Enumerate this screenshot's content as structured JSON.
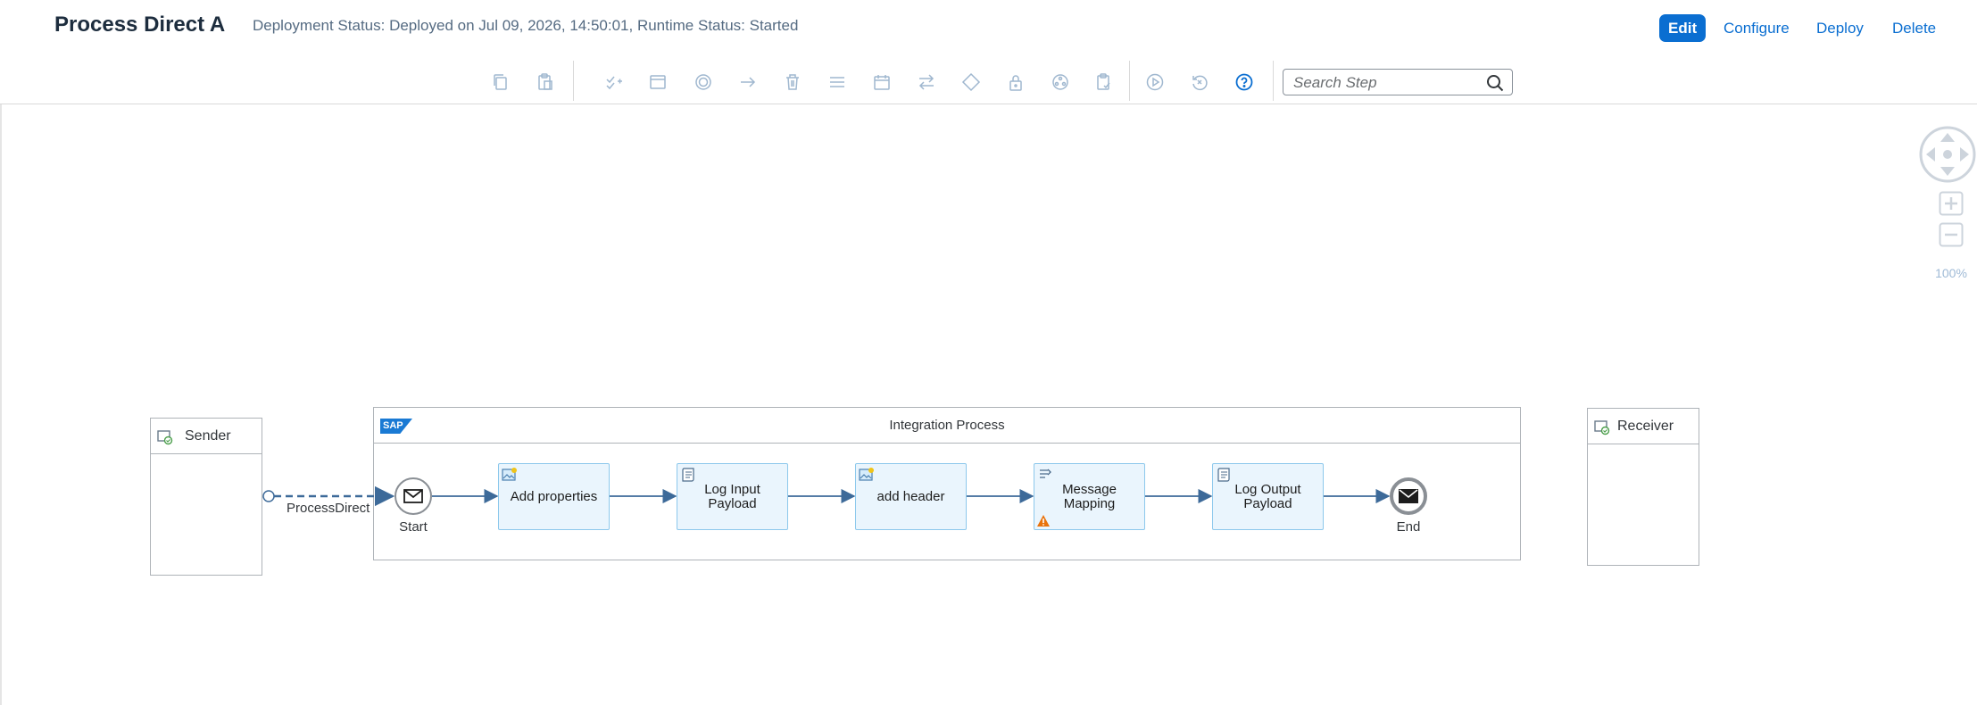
{
  "header": {
    "title": "Process Direct A",
    "status": "Deployment Status: Deployed on Jul 09, 2026, 14:50:01, Runtime Status: Started",
    "buttons": {
      "edit": "Edit",
      "configure": "Configure",
      "deploy": "Deploy",
      "delete": "Delete"
    }
  },
  "toolbar": {
    "tools": [
      "copy-icon",
      "paste-icon",
      "checklist-icon",
      "participant-icon",
      "events-icon",
      "connector-icon",
      "delete-icon",
      "menu-icon",
      "schedule-icon",
      "routing-icon",
      "gateway-icon",
      "security-icon",
      "call-icon",
      "validate-icon",
      "simulate-icon",
      "reset-icon",
      "help-icon"
    ],
    "search": {
      "placeholder": "Search Step"
    }
  },
  "canvas": {
    "zoom": "100%",
    "sender": {
      "label": "Sender"
    },
    "receiver": {
      "label": "Receiver"
    },
    "adapter": {
      "label": "ProcessDirect"
    },
    "integration_process": {
      "label": "Integration Process",
      "logo": "SAP"
    },
    "start": {
      "label": "Start"
    },
    "end": {
      "label": "End"
    },
    "steps": [
      {
        "label": "Add properties",
        "icon": "content-modifier-icon"
      },
      {
        "label": "Log Input Payload",
        "icon": "script-icon"
      },
      {
        "label": "add header",
        "icon": "content-modifier-icon"
      },
      {
        "label": "Message Mapping",
        "icon": "mapping-icon",
        "warning": true
      },
      {
        "label": "Log Output Payload",
        "icon": "script-icon"
      }
    ]
  }
}
